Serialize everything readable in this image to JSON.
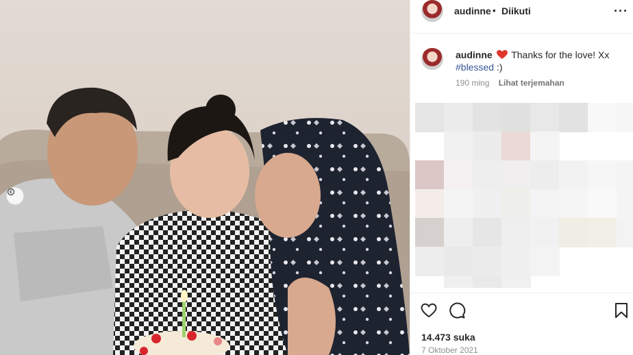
{
  "post": {
    "username": "audinne",
    "separator": "•",
    "follow_status": "Diikuti",
    "caption_username": "audinne",
    "caption_text": "Thanks for the love! Xx",
    "hashtag": "#blessed",
    "caption_suffix": " :)",
    "time_ago": "190 ming",
    "translate_label": "Lihat terjemahan",
    "likes": "14.473 suka",
    "date": "7 Oktober 2021"
  },
  "icons": {
    "more": "more-options-icon",
    "like": "heart-outline-icon",
    "comment": "comment-bubble-icon",
    "save": "bookmark-icon",
    "prev": "chevron-left-icon",
    "caption_emoji": "red-heart-emoji"
  },
  "colors": {
    "heart_emoji": "#e0352b",
    "hashtag": "#385898",
    "muted": "#8e8e8e"
  }
}
